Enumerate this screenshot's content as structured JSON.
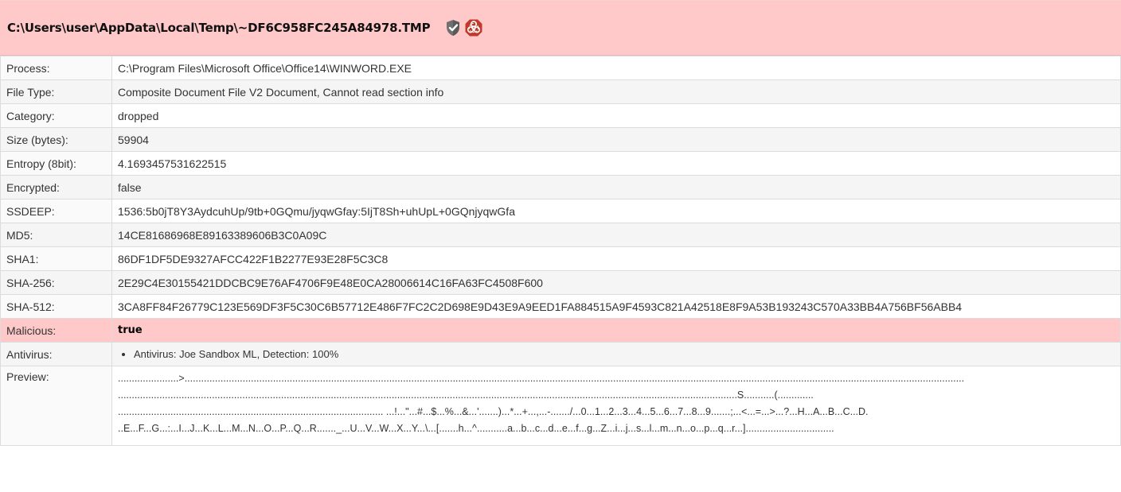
{
  "header": {
    "title": "C:\\Users\\user\\AppData\\Local\\Temp\\~DF6C958FC245A84978.TMP",
    "icons": [
      "shield-check-icon",
      "biohazard-icon"
    ],
    "background": "#ffc9c9"
  },
  "rows": {
    "process": {
      "label": "Process:",
      "value": "C:\\Program Files\\Microsoft Office\\Office14\\WINWORD.EXE"
    },
    "file_type": {
      "label": "File Type:",
      "value": "Composite Document File V2 Document, Cannot read section info"
    },
    "category": {
      "label": "Category:",
      "value": "dropped"
    },
    "size": {
      "label": "Size (bytes):",
      "value": "59904"
    },
    "entropy": {
      "label": "Entropy (8bit):",
      "value": "4.1693457531622515"
    },
    "encrypted": {
      "label": "Encrypted:",
      "value": "false"
    },
    "ssdeep": {
      "label": "SSDEEP:",
      "value": "1536:5b0jT8Y3AydcuhUp/9tb+0GQmu/jyqwGfay:5IjT8Sh+uhUpL+0GQnjyqwGfa"
    },
    "md5": {
      "label": "MD5:",
      "value": "14CE81686968E89163389606B3C0A09C"
    },
    "sha1": {
      "label": "SHA1:",
      "value": "86DF1DF5DE9327AFCC422F1B2277E93E28F5C3C8"
    },
    "sha256": {
      "label": "SHA-256:",
      "value": "2E29C4E30155421DDCBC9E76AF4706F9E48E0CA28006614C16FA63FC4508F600"
    },
    "sha512": {
      "label": "SHA-512:",
      "value": "3CA8FF84F26779C123E569DF3F5C30C6B57712E486F7FC2C2D698E9D43E9A9EED1FA884515A9F4593C821A42518E8F9A53B193243C570A33BB4A756BF56ABB4"
    },
    "malicious": {
      "label": "Malicious:",
      "value": "true"
    },
    "antivirus": {
      "label": "Antivirus:",
      "item": "Antivirus: Joe Sandbox ML, Detection: 100%"
    },
    "preview": {
      "label": "Preview:",
      "lines": [
        "......................>..........................................................................................................................................................................................................................................................................................",
        "................................................................................................................................................................................................................................S...........(.............",
        "................................................................................................ ...!...\"...#...$...%...&...'.......)...*...+...,...-......./...0...1...2...3...4...5...6...7...8...9.......;...<...=...>...?...H...A...B...C...D.",
        "..E...F...G...:...I...J...K...L...M...N...O...P...Q...R......._...U...V...W...X...Y...\\...[.......h...^...........a...b...c...d...e...f...g...Z...i...j...s...l...m...n...o...p...q...r...]................................"
      ]
    }
  },
  "colors": {
    "malicious_row": "#ffc9c9",
    "border": "#dcdcdc"
  }
}
